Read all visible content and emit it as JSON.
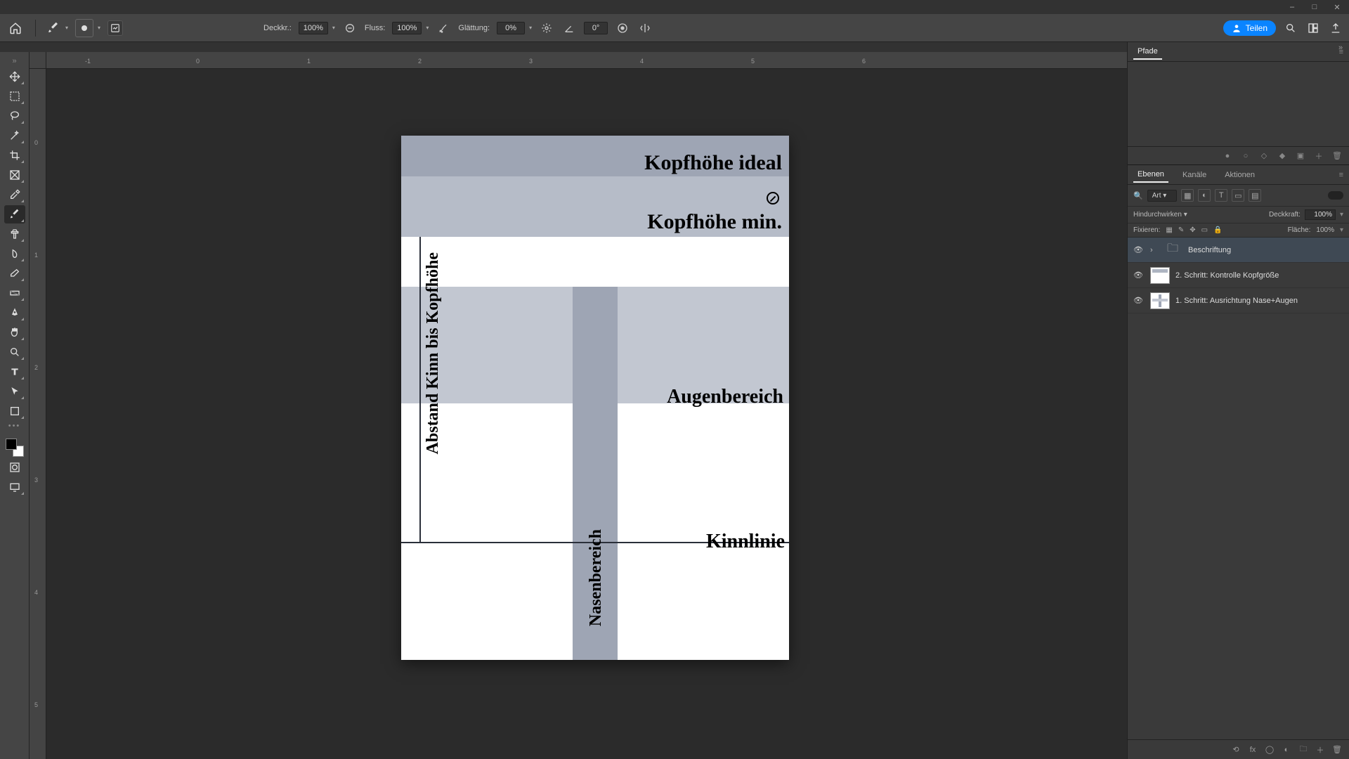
{
  "titlebar": {
    "minimize": "–",
    "maximize": "□",
    "close": "✕"
  },
  "options": {
    "opacity_label": "Deckkr.:",
    "opacity_value": "100%",
    "flow_label": "Fluss:",
    "flow_value": "100%",
    "smoothing_label": "Glättung:",
    "smoothing_value": "0%",
    "angle_value": "0°",
    "share_label": "Teilen"
  },
  "ruler_h": [
    "-1",
    "0",
    "1",
    "2",
    "3",
    "4",
    "5",
    "6"
  ],
  "ruler_v": [
    "0",
    "1",
    "2",
    "3",
    "4",
    "5"
  ],
  "artboard": {
    "kopfhoehe_ideal": "Kopfhöhe ideal",
    "kopfhoehe_min": "Kopfhöhe min.",
    "augenbereich": "Augenbereich",
    "kinnlinie": "Kinnlinie",
    "abstand": "Abstand Kinn bis Kopfhöhe",
    "nasenbereich": "Nasenbereich"
  },
  "panels": {
    "paths_tab": "Pfade",
    "layers_tab": "Ebenen",
    "channels_tab": "Kanäle",
    "actions_tab": "Aktionen",
    "search_kind": "Art",
    "blend_mode": "Hindurchwirken",
    "opacity_label": "Deckkraft:",
    "opacity_value": "100%",
    "lock_label": "Fixieren:",
    "fill_label": "Fläche:",
    "fill_value": "100%"
  },
  "layers": [
    {
      "name": "Beschriftung",
      "type": "group",
      "visible": true,
      "selected": true
    },
    {
      "name": "2. Schritt: Kontrolle Kopfgröße",
      "type": "layer",
      "visible": true,
      "selected": false
    },
    {
      "name": "1. Schritt: Ausrichtung Nase+Augen",
      "type": "layer",
      "visible": true,
      "selected": false
    }
  ]
}
